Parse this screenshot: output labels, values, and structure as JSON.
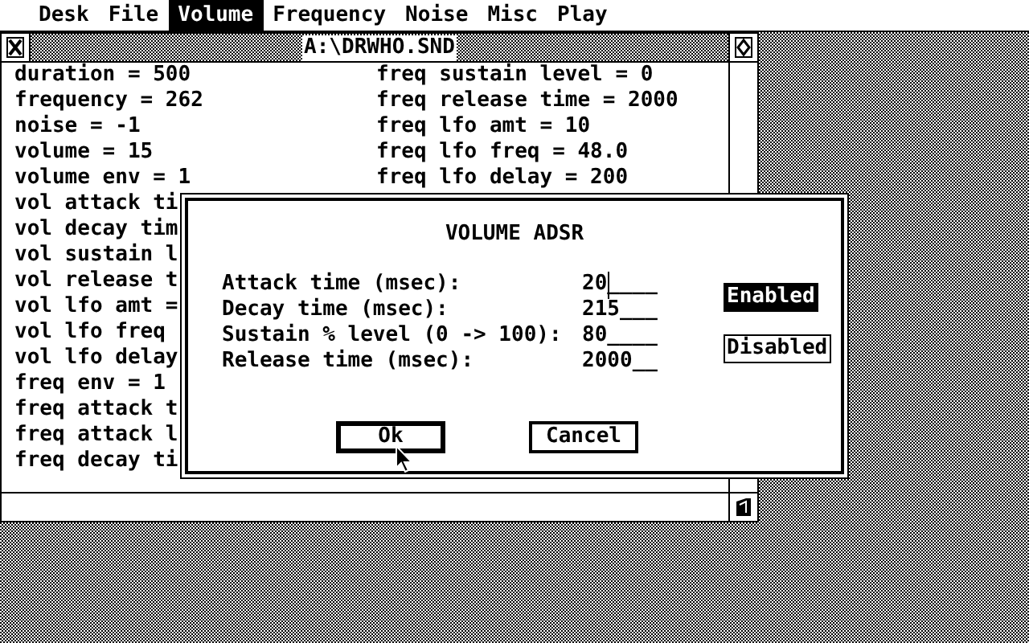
{
  "menu_bar": [
    {
      "label": "Desk",
      "selected": false
    },
    {
      "label": "File",
      "selected": false
    },
    {
      "label": "Volume",
      "selected": true
    },
    {
      "label": "Frequency",
      "selected": false
    },
    {
      "label": "Noise",
      "selected": false
    },
    {
      "label": "Misc",
      "selected": false
    },
    {
      "label": "Play",
      "selected": false
    }
  ],
  "window": {
    "title": "A:\\DRWHO.SND",
    "lines_left": [
      "duration = 500",
      "frequency = 262",
      "noise = -1",
      "volume = 15",
      "volume env = 1",
      "vol attack ti",
      "vol decay tim",
      "vol sustain l",
      "vol release t",
      "vol lfo amt =",
      "vol lfo freq",
      "vol lfo delay",
      "freq env = 1",
      "freq attack t",
      "freq attack l",
      "freq decay ti"
    ],
    "lines_right": [
      "freq sustain level = 0",
      "freq release time = 2000",
      "freq lfo amt = 10",
      "freq lfo freq = 48.0",
      "freq lfo delay = 200"
    ]
  },
  "dialog": {
    "title": "VOLUME ADSR",
    "fields": [
      {
        "label": "Attack time (msec):",
        "value": "20",
        "blanks": "____",
        "focused": true
      },
      {
        "label": "Decay time (msec):",
        "value": "215",
        "blanks": "___",
        "focused": false
      },
      {
        "label": "Sustain % level (0 -> 100):",
        "value": "80",
        "blanks": "____",
        "focused": false
      },
      {
        "label": "Release time (msec):",
        "value": "2000",
        "blanks": "__",
        "focused": false
      }
    ],
    "toggles": [
      {
        "label": "Enabled",
        "selected": true
      },
      {
        "label": "Disabled",
        "selected": false
      }
    ],
    "buttons": [
      {
        "label": "Ok",
        "default": true
      },
      {
        "label": "Cancel",
        "default": false
      }
    ]
  }
}
